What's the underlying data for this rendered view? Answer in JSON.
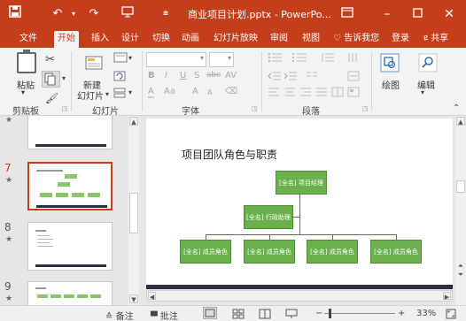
{
  "titlebar": {
    "title": "商业项目计划.pptx - PowerPo...",
    "save_icon": "save-icon",
    "undo_icon": "undo-icon",
    "redo_icon": "redo-icon",
    "presentation_icon": "from-beginning-icon",
    "customize_icon": "customize-toolbar-icon",
    "ribbon_display_icon": "ribbon-display-options-icon",
    "minimize_icon": "minimize-icon",
    "maximize_icon": "maximize-icon",
    "close_icon": "close-icon"
  },
  "tabs": {
    "file": "文件",
    "home": "开始",
    "insert": "插入",
    "design": "设计",
    "transitions": "切换",
    "animations": "动画",
    "slideshow": "幻灯片放映",
    "review": "审阅",
    "view": "视图",
    "tellme": "告诉我您",
    "signin": "登录",
    "share": "共享"
  },
  "ribbon": {
    "clipboard": {
      "group_label": "剪贴板",
      "paste_label": "粘贴",
      "cut_icon": "scissors-icon",
      "copy_icon": "copy-icon",
      "format_painter_icon": "format-painter-icon"
    },
    "slides": {
      "group_label": "幻灯片",
      "new_slide_label_1": "新建",
      "new_slide_label_2": "幻灯片"
    },
    "font": {
      "group_label": "字体",
      "bold": "B",
      "italic": "I",
      "underline": "U",
      "shadow": "S",
      "strike": "abc",
      "spacing": "AV",
      "font_color": "A",
      "change_case": "Aa",
      "grow": "A",
      "shrink": "A"
    },
    "paragraph": {
      "group_label": "段落"
    },
    "drawing": {
      "label": "绘图"
    },
    "editing": {
      "label": "编辑"
    },
    "collapse_icon": "collapse-ribbon-icon"
  },
  "thumbnails": {
    "slides": [
      {
        "number": "",
        "star": "★"
      },
      {
        "number": "7",
        "star": "★"
      },
      {
        "number": "8",
        "star": "★"
      },
      {
        "number": "9",
        "star": "★"
      }
    ]
  },
  "slide": {
    "title": "项目团队角色与职责",
    "top_node": "[全名] 项目经理",
    "mid_node": "[全名] 行政助理",
    "bottom_nodes": [
      "[全名] 成员角色",
      "[全名] 成员角色",
      "[全名] 成员角色",
      "[全名] 成员角色"
    ]
  },
  "statusbar": {
    "notes": "备注",
    "comments": "批注",
    "zoom": "33%",
    "minus": "−",
    "plus": "+"
  },
  "colors": {
    "accent": "#c43e1c",
    "node_green": "#6ab04c"
  }
}
